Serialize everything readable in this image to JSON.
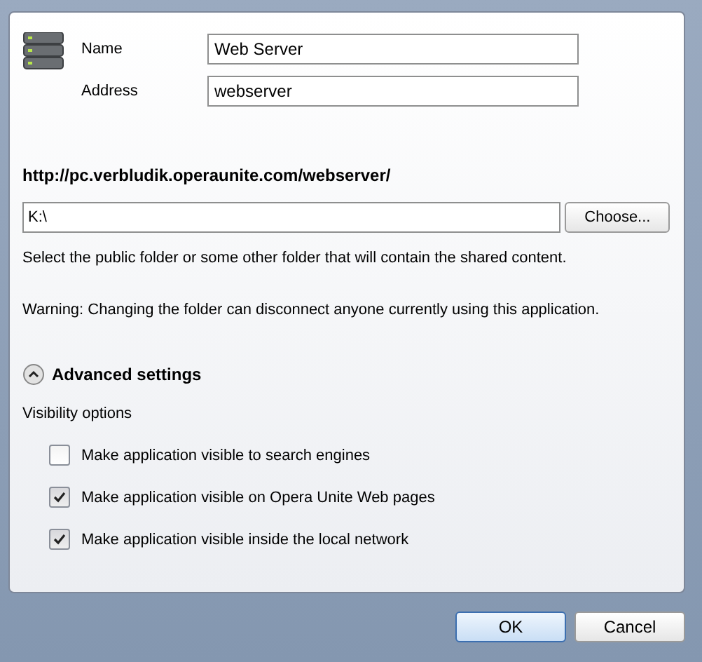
{
  "fields": [
    {
      "label": "Name",
      "value": "Web Server"
    },
    {
      "label": "Address",
      "value": "webserver"
    }
  ],
  "url": "http://pc.verbludik.operaunite.com/webserver/",
  "folder": {
    "value": "K:\\",
    "button": "Choose..."
  },
  "hint": "Select the public folder or some other folder that will contain the shared content.",
  "warning": "Warning: Changing the folder can disconnect anyone currently using this application.",
  "advanced": {
    "title": "Advanced settings",
    "expanded": true
  },
  "visibility_label": "Visibility options",
  "options": [
    {
      "label": "Make application visible to search engines",
      "checked": false
    },
    {
      "label": "Make application visible on Opera Unite Web pages",
      "checked": true
    },
    {
      "label": "Make application visible inside the local network",
      "checked": true
    }
  ],
  "buttons": [
    {
      "label": "OK",
      "default": true
    },
    {
      "label": "Cancel",
      "default": false
    }
  ]
}
